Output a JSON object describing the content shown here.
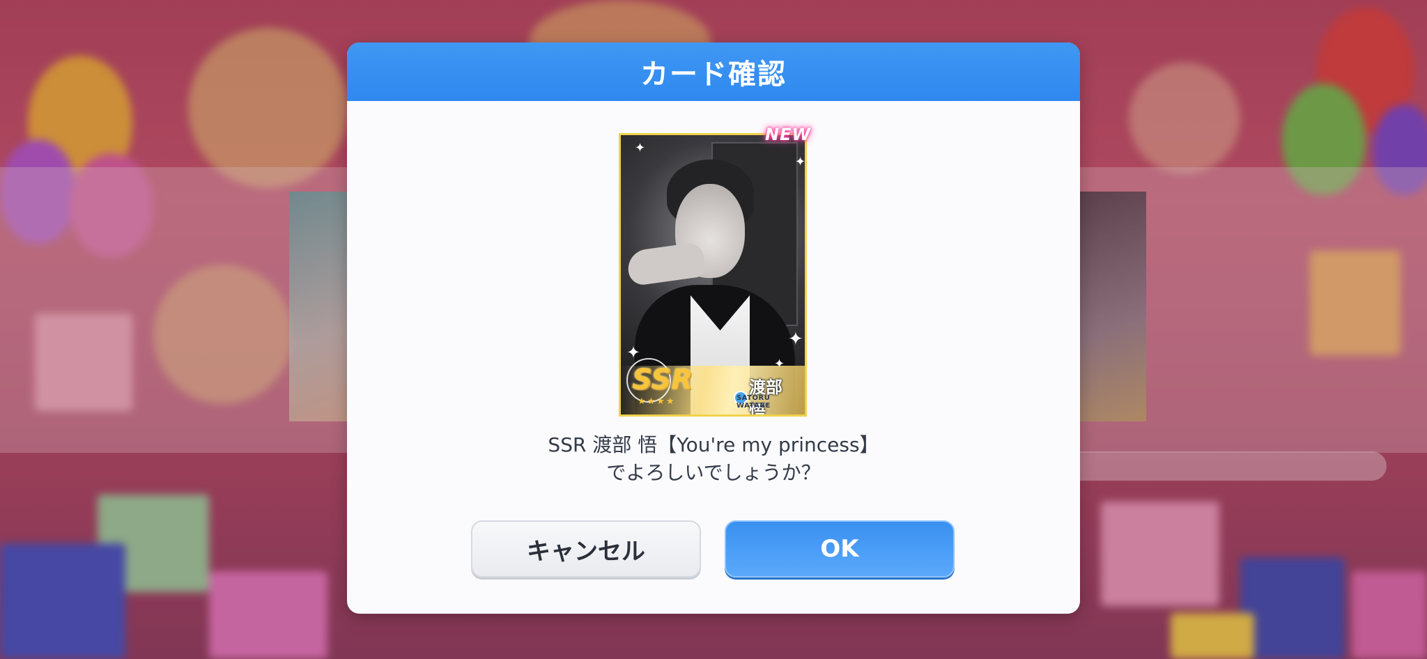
{
  "dialog": {
    "title": "カード確認",
    "message_line1": "SSR 渡部 悟【You're my princess】",
    "message_line2": "でよろしいでしょうか？",
    "cancel_label": "キャンセル",
    "ok_label": "OK"
  },
  "card": {
    "rarity": "SSR",
    "rarity_stars": "★★★★",
    "new_badge": "NEW",
    "character_name": "渡部 悟",
    "character_name_en": "SATORU WATABE",
    "attribute_icon": "blue-attribute-icon",
    "sparkle_glyph": "✦"
  },
  "colors": {
    "header_blue": "#3f98f3",
    "ok_button": "#4a9df5",
    "card_border_gold": "#f0d24a",
    "new_glow_pink": "#ff3c9e"
  }
}
